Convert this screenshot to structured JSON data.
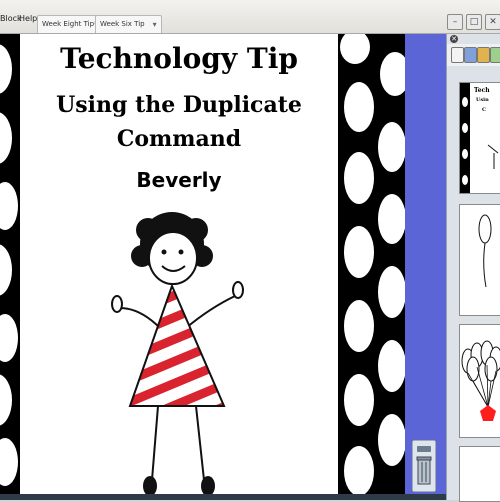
{
  "menu": {
    "items": [
      "Block",
      "Help"
    ]
  },
  "tabs": [
    {
      "label": "Week Eight Tip*"
    },
    {
      "label": "Week Six Tip"
    }
  ],
  "page": {
    "title": "Technology Tip",
    "subtitle_line1": "Using the Duplicate",
    "subtitle_line2": "Command",
    "author": "Beverly"
  },
  "sidebar": {
    "thumb1_text_a": "Tech",
    "thumb1_text_b": "Usin",
    "thumb1_text_c": "C"
  },
  "colors": {
    "dress_red": "#d9232e",
    "sidebar_strip": "#5b65d6",
    "balloon_red": "#ff1e1e"
  }
}
